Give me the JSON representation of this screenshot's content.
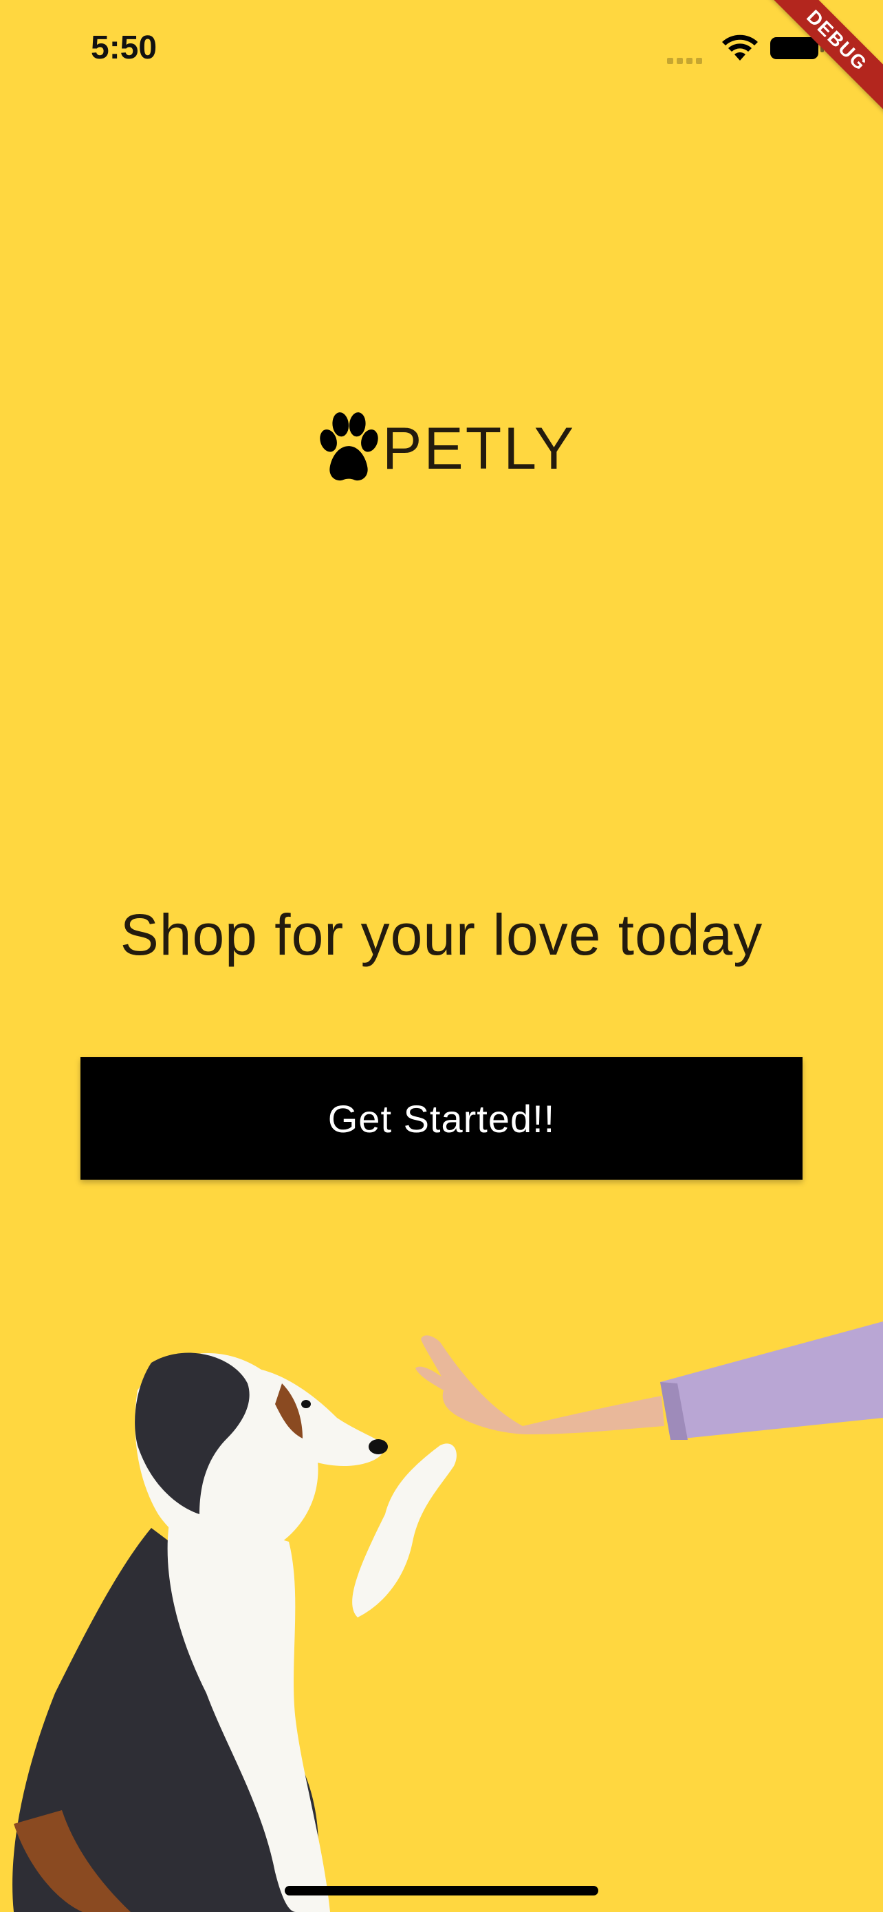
{
  "status_bar": {
    "time": "5:50",
    "debug_label": "DEBUG"
  },
  "logo": {
    "icon": "paw-icon",
    "text": "PETLY"
  },
  "tagline": "Shop for your love today",
  "cta": {
    "label": "Get Started!!"
  },
  "hero": {
    "subject": "dog giving a high-five to a human hand"
  },
  "colors": {
    "background": "#FFD740",
    "button_bg": "#000000",
    "button_text": "#FFFFFF",
    "debug_ribbon": "#B3261E"
  }
}
